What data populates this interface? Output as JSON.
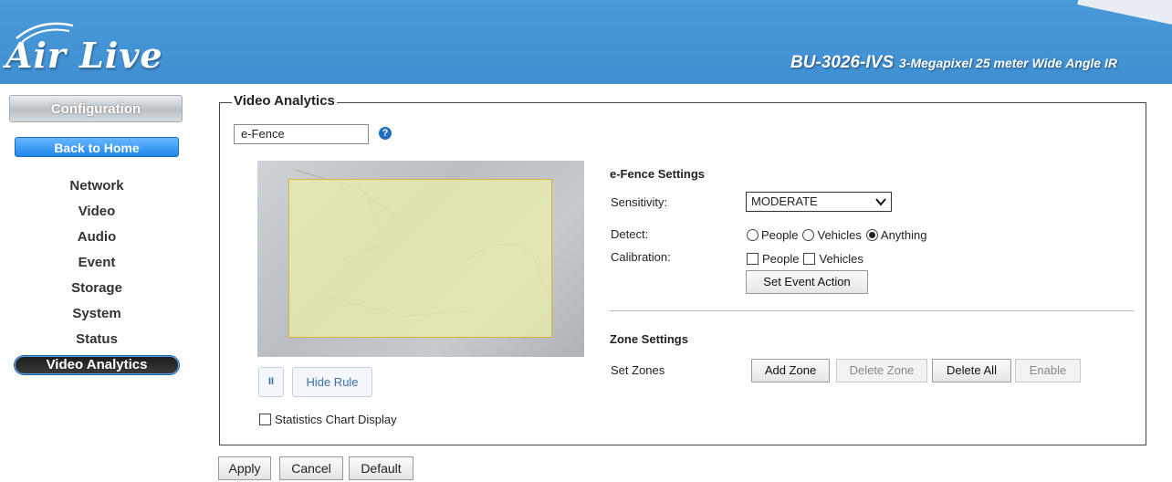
{
  "header": {
    "logo_text": "Air Live",
    "model_name": "BU-3026-IVS",
    "model_desc": "3-Megapixel 25 meter Wide Angle IR"
  },
  "sidebar": {
    "configuration_label": "Configuration",
    "back_home_label": "Back to Home",
    "items": [
      {
        "label": "Network"
      },
      {
        "label": "Video"
      },
      {
        "label": "Audio"
      },
      {
        "label": "Event"
      },
      {
        "label": "Storage"
      },
      {
        "label": "System"
      },
      {
        "label": "Status"
      },
      {
        "label": "Video Analytics"
      }
    ]
  },
  "main": {
    "section_title": "Video Analytics",
    "mode_value": "e-Fence",
    "help_icon": "?",
    "pause_label": "II",
    "hide_rule_label": "Hide Rule",
    "statistics_label": "Statistics Chart Display",
    "statistics_checked": false
  },
  "efence": {
    "title": "e-Fence Settings",
    "sensitivity_label": "Sensitivity:",
    "sensitivity_value": "MODERATE",
    "detect_label": "Detect:",
    "detect_options": [
      "People",
      "Vehicles",
      "Anything"
    ],
    "detect_selected": "Anything",
    "calibration_label": "Calibration:",
    "calibration_options": [
      "People",
      "Vehicles"
    ],
    "set_event_action_label": "Set Event Action"
  },
  "zone": {
    "title": "Zone Settings",
    "set_zones_label": "Set Zones",
    "add_zone_label": "Add Zone",
    "delete_zone_label": "Delete Zone",
    "delete_all_label": "Delete All",
    "enable_label": "Enable"
  },
  "footer": {
    "apply_label": "Apply",
    "cancel_label": "Cancel",
    "default_label": "Default"
  }
}
